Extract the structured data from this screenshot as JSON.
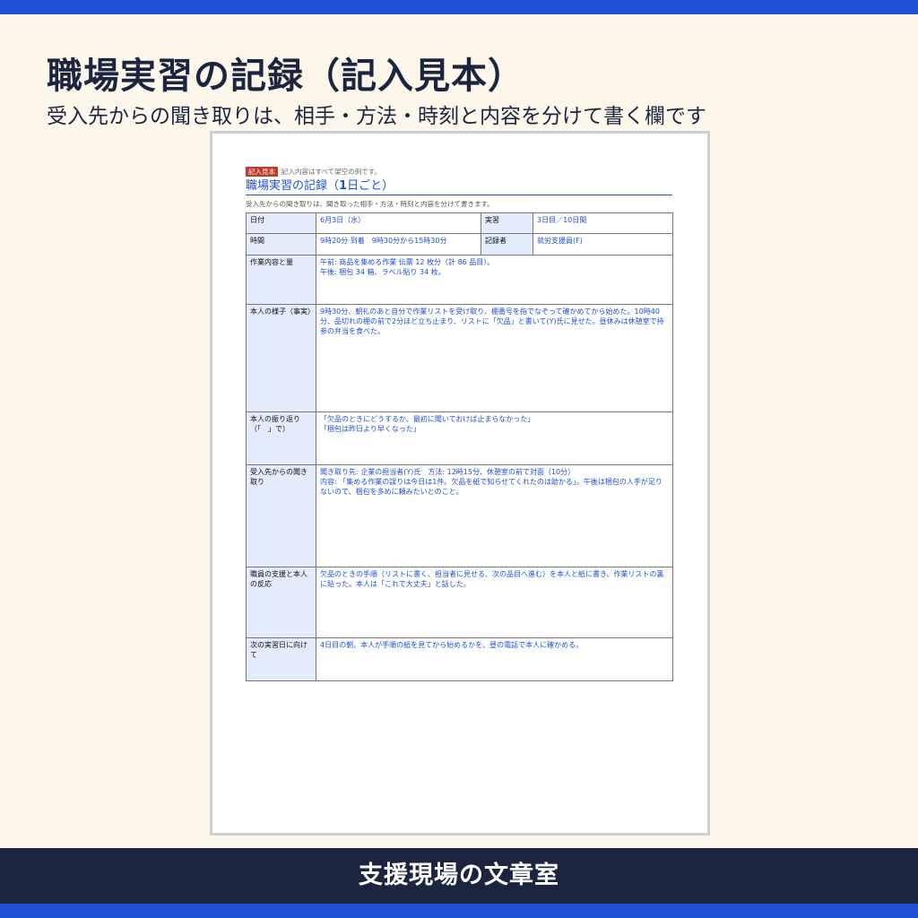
{
  "header": {
    "title": "職場実習の記録（記入見本）",
    "subtitle": "受入先からの聞き取りは、相手・方法・時刻と内容を分けて書く欄です"
  },
  "document": {
    "badge": "記入見本",
    "badge_note": "記入内容はすべて架空の例です。",
    "title_prefix": "職場実習の記録（",
    "title_bold": "1",
    "title_suffix": "日ごと）",
    "note": "受入先からの聞き取りは、聞き取った相手・方法・時刻と内容を分けて書きます。",
    "rows": {
      "date_label": "日付",
      "date_value": "6月3日（水）",
      "practice_label": "実習",
      "practice_value": "3日目／10日間",
      "time_label": "時間",
      "time_value": "9時20分 到着　9時30分から15時30分",
      "recorder_label": "記録者",
      "recorder_value": "就労支援員(F)",
      "work_label": "作業内容と量",
      "work_value_1": "午前: 商品を集める作業 伝票 12 枚分（計 86 品目）。",
      "work_value_2": "午後: 梱包 34 箱、ラベル貼り 34 枚。",
      "state_label": "本人の様子（事実）",
      "state_value": "9時30分、朝礼のあと自分で作業リストを受け取り、棚番号を指でなぞって確かめてから始めた。10時40分、品切れの棚の前で2分ほど立ち止まり、リストに「欠品」と書いて(Y)氏に見せた。昼休みは休憩室で持参の弁当を食べた。",
      "reflection_label": "本人の振り返り（「　」で）",
      "reflection_value_1": "「欠品のときにどうするか、最初に聞いておけば止まらなかった」",
      "reflection_value_2": "「梱包は昨日より早くなった」",
      "interview_label": "受入先からの聞き取り",
      "interview_value_1": "聞き取り先: 企業の担当者(Y)氏　方法: 12時15分、休憩室の前で対面（10分）",
      "interview_value_2": "内容: 「集める作業の誤りは今日は1件。欠品を紙で知らせてくれたのは助かる」。午後は梱包の人手が足りないので、梱包を多めに頼みたいとのこと。",
      "support_label": "職員の支援と本人の反応",
      "support_value": "欠品のときの手順（リストに書く、担当者に見せる、次の品目へ進む）を本人と紙に書き、作業リストの裏に貼った。本人は「これで大丈夫」と話した。",
      "next_label": "次の実習日に向けて",
      "next_value": "4日目の朝、本人が手順の紙を見てから始めるかを、昼の電話で本人に確かめる。"
    }
  },
  "footer": {
    "text": "支援現場の文章室"
  },
  "colors": {
    "accent_blue": "#1e4fd6",
    "navy": "#1c2540",
    "background": "#fdf6ea",
    "badge_red": "#c0392b",
    "label_cell": "#e4ebfa"
  }
}
